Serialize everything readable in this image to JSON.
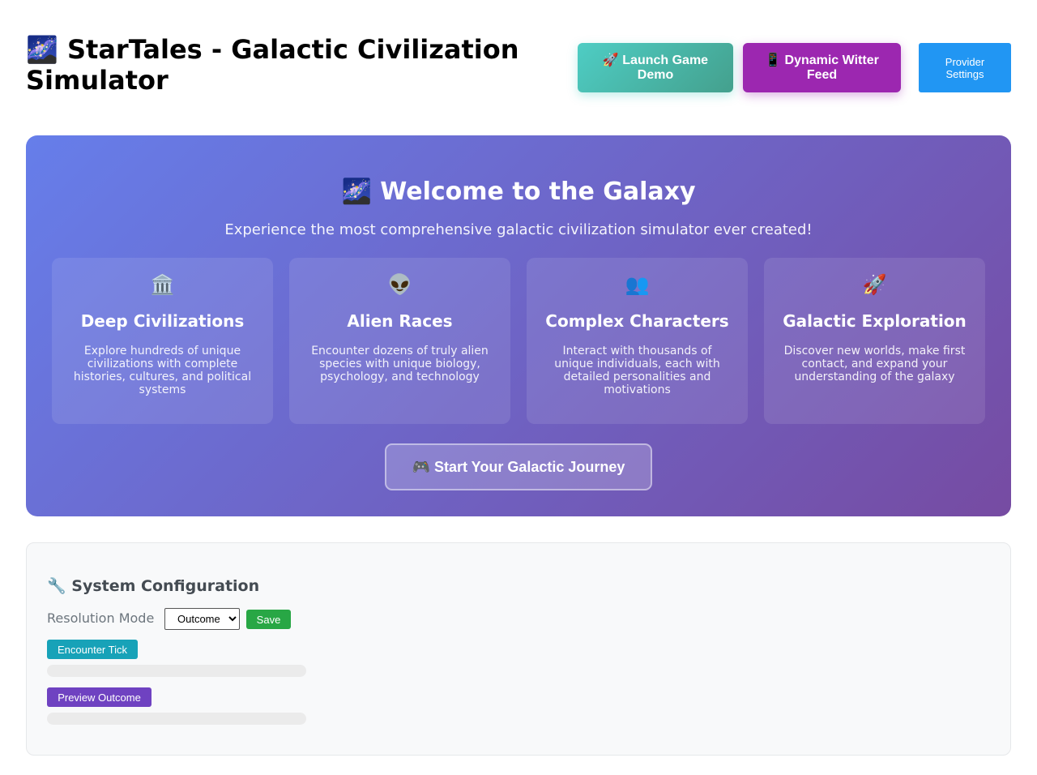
{
  "header": {
    "title": "🌌 StarTales - Galactic Civilization Simulator",
    "buttons": {
      "launch": "🚀 Launch Game Demo",
      "witter": "📱 Dynamic Witter Feed",
      "provider": "Provider Settings"
    }
  },
  "hero": {
    "title": "🌌 Welcome to the Galaxy",
    "subtitle": "Experience the most comprehensive galactic civilization simulator ever created!",
    "features": [
      {
        "icon": "🏛️",
        "icon_name": "classical-building-icon",
        "title": "Deep Civilizations",
        "description": "Explore hundreds of unique civilizations with complete histories, cultures, and political systems"
      },
      {
        "icon": "👽",
        "icon_name": "alien-icon",
        "title": "Alien Races",
        "description": "Encounter dozens of truly alien species with unique biology, psychology, and technology"
      },
      {
        "icon": "👥",
        "icon_name": "people-icon",
        "title": "Complex Characters",
        "description": "Interact with thousands of unique individuals, each with detailed personalities and motivations"
      },
      {
        "icon": "🚀",
        "icon_name": "rocket-icon",
        "title": "Galactic Exploration",
        "description": "Discover new worlds, make first contact, and expand your understanding of the galaxy"
      }
    ],
    "start_button": "🎮 Start Your Galactic Journey"
  },
  "config": {
    "title": "🔧 System Configuration",
    "resolution_label": "Resolution Mode",
    "resolution_value": "Outcome",
    "save": "Save",
    "encounter_tick": "Encounter Tick",
    "preview_outcome": "Preview Outcome"
  },
  "colors": {
    "hero_gradient_start": "#667eea",
    "hero_gradient_end": "#764ba2",
    "launch_gradient_start": "#4ecdc4",
    "launch_gradient_end": "#44a08d",
    "witter": "#9c27b0",
    "provider": "#2196f3",
    "save": "#28a745",
    "encounter_tick": "#17a2b8",
    "preview_outcome": "#6f42c1"
  }
}
